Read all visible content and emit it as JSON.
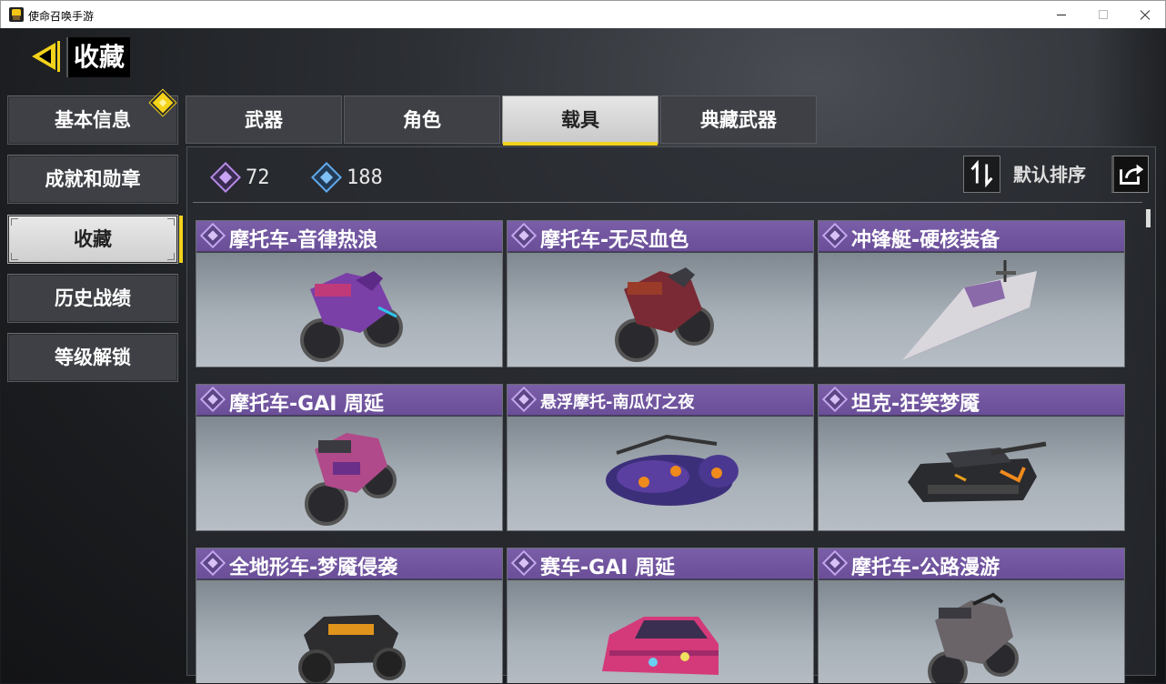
{
  "window": {
    "title": "使命召唤手游"
  },
  "header": {
    "title": "收藏"
  },
  "sidebar": {
    "items": [
      {
        "label": "基本信息"
      },
      {
        "label": "成就和勋章"
      },
      {
        "label": "收藏"
      },
      {
        "label": "历史战绩"
      },
      {
        "label": "等级解锁"
      }
    ]
  },
  "tabs": [
    {
      "label": "武器"
    },
    {
      "label": "角色"
    },
    {
      "label": "载具"
    },
    {
      "label": "典藏武器"
    }
  ],
  "stats": {
    "purple_count": "72",
    "blue_count": "188"
  },
  "sort": {
    "label": "默认排序"
  },
  "cards": [
    {
      "name": "摩托车-音律热浪"
    },
    {
      "name": "摩托车-无尽血色"
    },
    {
      "name": "冲锋艇-硬核装备"
    },
    {
      "name": "摩托车-GAI 周延"
    },
    {
      "name": "悬浮摩托-南瓜灯之夜"
    },
    {
      "name": "坦克-狂笑梦魇"
    },
    {
      "name": "全地形车-梦魇侵袭"
    },
    {
      "name": "赛车-GAI 周延"
    },
    {
      "name": "摩托车-公路漫游"
    }
  ],
  "colors": {
    "accent": "#f2d21b",
    "card_banner": "#6a4f98",
    "active_tab": "#d9d9d9"
  }
}
